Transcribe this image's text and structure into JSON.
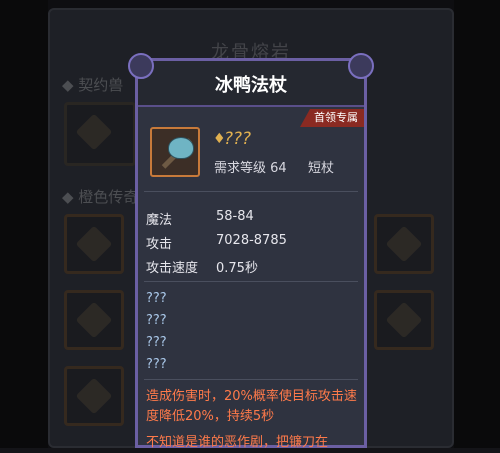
{
  "background": {
    "title": "龙骨熔岩",
    "section_1": "◆ 契约兽",
    "section_2": "◆ 橙色传奇"
  },
  "tooltip": {
    "title": "冰鸭法杖",
    "badge": "首领专属",
    "name_unknown": "???",
    "required_level": "需求等级 64",
    "weapon_type": "短杖",
    "stats": [
      {
        "label": "魔法",
        "value": "58-84"
      },
      {
        "label": "攻击",
        "value": "7028-8785"
      },
      {
        "label": "攻击速度",
        "value": "0.75秒"
      }
    ],
    "unknown_affixes": [
      "???",
      "???",
      "???",
      "???"
    ],
    "effect": "造成伤害时，20%概率使目标攻击速度降低20%，持续5秒",
    "effect_partial": "不知道是谁的恶作剧，把镰刀在"
  },
  "colors": {
    "frame": "#6b5fa3",
    "effect_text": "#ff7a4a",
    "unknown_text": "#a9c7e8",
    "legendary_name": "#e0b050",
    "badge": "#8a2a22"
  }
}
